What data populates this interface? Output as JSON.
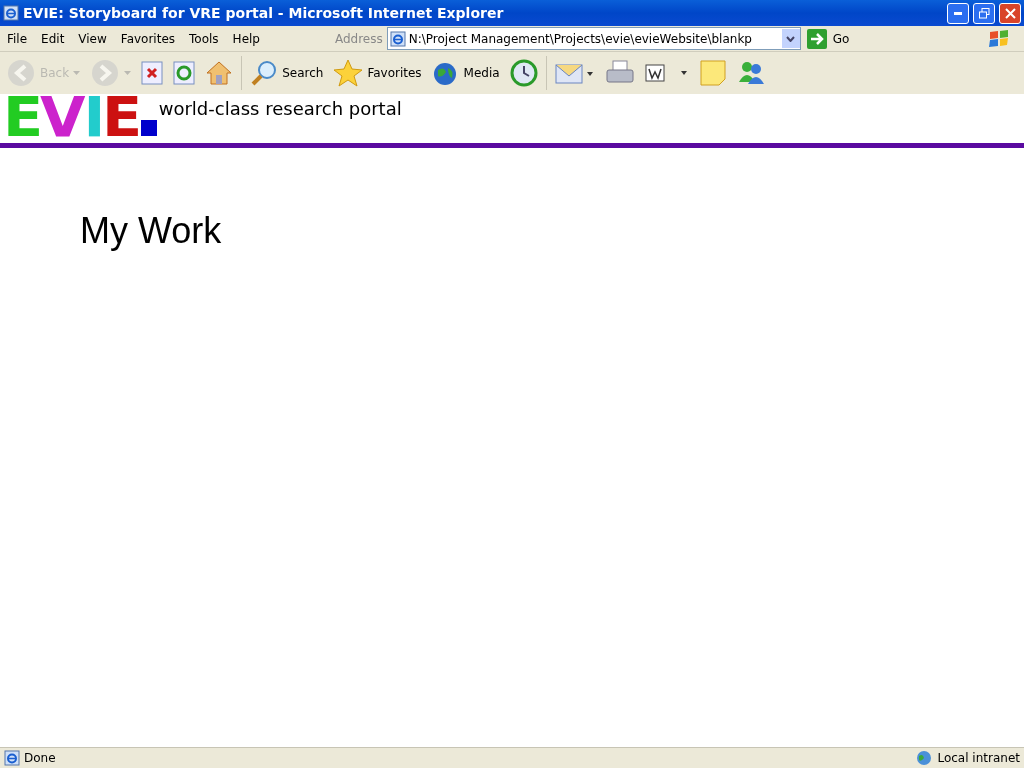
{
  "window": {
    "title": "EVIE: Storyboard for VRE portal - Microsoft Internet Explorer"
  },
  "menu": [
    "File",
    "Edit",
    "View",
    "Favorites",
    "Tools",
    "Help"
  ],
  "address": {
    "label": "Address",
    "value": "N:\\Project Management\\Projects\\evie\\evieWebsite\\blankp",
    "go": "Go"
  },
  "toolbar": [
    {
      "kind": "back",
      "label": "Back",
      "disabled": true
    },
    {
      "kind": "forward",
      "disabled": true
    },
    {
      "kind": "stop",
      "disabled": false
    },
    {
      "kind": "refresh",
      "disabled": false
    },
    {
      "kind": "home",
      "disabled": false
    },
    {
      "kind": "search",
      "label": "Search",
      "disabled": false
    },
    {
      "kind": "favorites",
      "label": "Favorites",
      "disabled": false
    },
    {
      "kind": "media",
      "label": "Media",
      "disabled": false
    },
    {
      "kind": "history",
      "disabled": false
    },
    {
      "kind": "mail",
      "disabled": false
    },
    {
      "kind": "print",
      "disabled": false
    },
    {
      "kind": "word",
      "disabled": false
    },
    {
      "kind": "notes",
      "disabled": false
    },
    {
      "kind": "messenger",
      "disabled": false
    }
  ],
  "page": {
    "logo": {
      "letters": [
        {
          "char": "E",
          "color": "#22cc22"
        },
        {
          "char": "V",
          "color": "#cc22cc"
        },
        {
          "char": "I",
          "color": "#22cccc"
        },
        {
          "char": "E",
          "color": "#cc1111"
        }
      ]
    },
    "tagline": "world-class research portal",
    "heading": "My Work"
  },
  "status_bar": {
    "text": "Done",
    "zone": "Local intranet"
  }
}
